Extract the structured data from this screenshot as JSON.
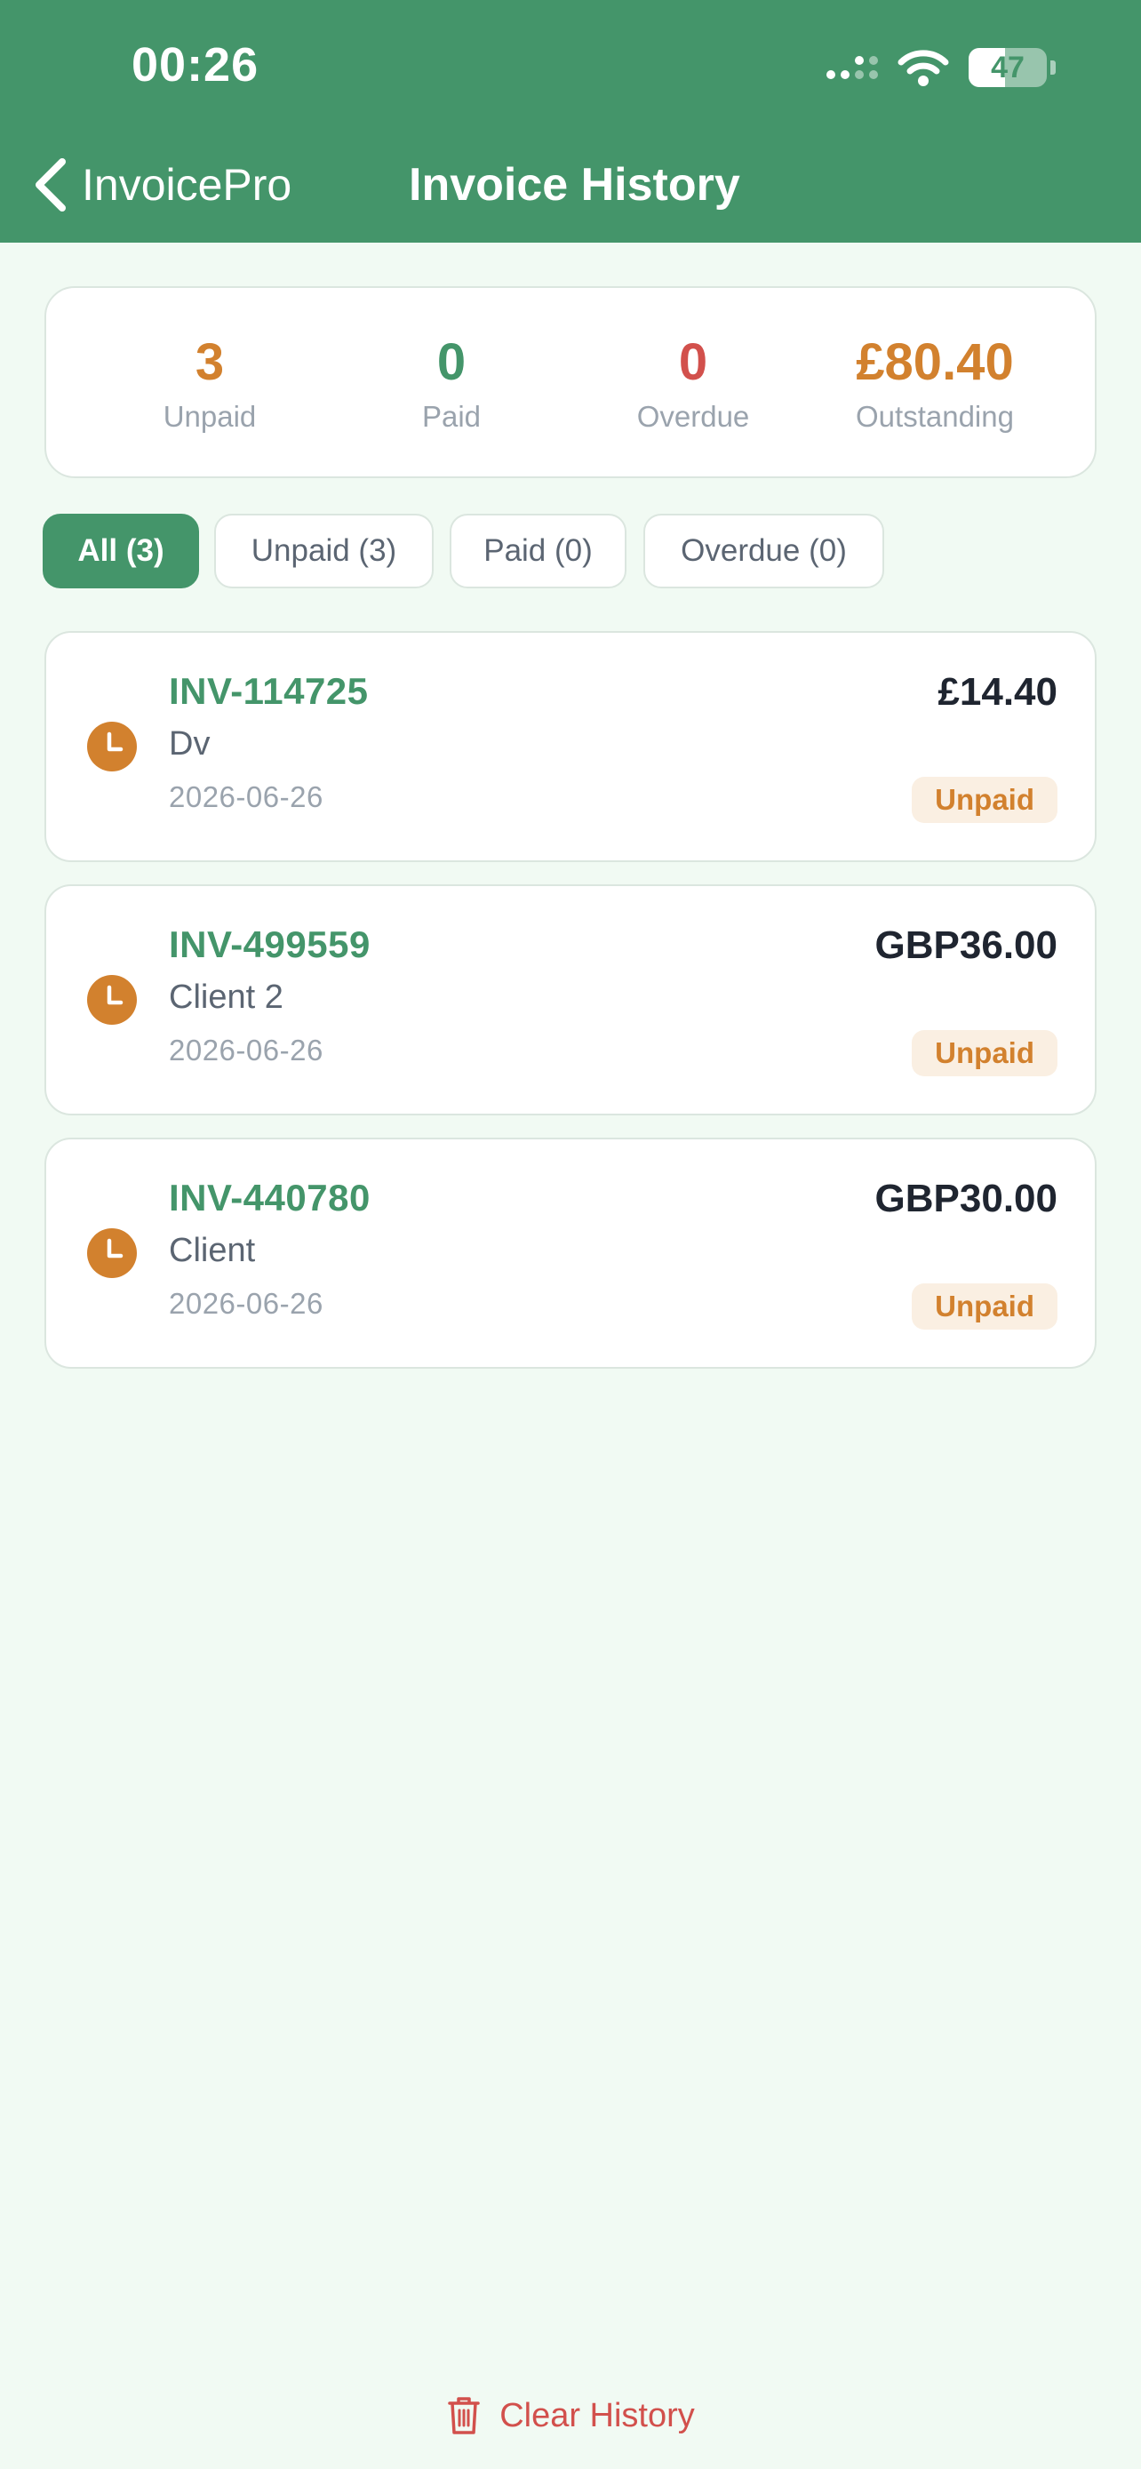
{
  "status_bar": {
    "time": "00:26",
    "battery": "47",
    "battery_level": 0.47
  },
  "nav": {
    "back_label": "InvoicePro",
    "title": "Invoice History"
  },
  "summary": [
    {
      "value": "3",
      "label": "Unpaid",
      "color": "#d2812e"
    },
    {
      "value": "0",
      "label": "Paid",
      "color": "#44956a"
    },
    {
      "value": "0",
      "label": "Overdue",
      "color": "#d2504c"
    },
    {
      "value": "£80.40",
      "label": "Outstanding",
      "color": "#d2812e"
    }
  ],
  "filters": [
    {
      "label": "All (3)",
      "active": true
    },
    {
      "label": "Unpaid (3)",
      "active": false
    },
    {
      "label": "Paid (0)",
      "active": false
    },
    {
      "label": "Overdue (0)",
      "active": false
    }
  ],
  "invoices": [
    {
      "number": "INV-114725",
      "client": "Dv",
      "date": "2026-06-26",
      "amount": "£14.40",
      "status": "Unpaid",
      "icon": "clock-icon"
    },
    {
      "number": "INV-499559",
      "client": "Client 2",
      "date": "2026-06-26",
      "amount": "GBP36.00",
      "status": "Unpaid",
      "icon": "clock-icon"
    },
    {
      "number": "INV-440780",
      "client": "Client",
      "date": "2026-06-26",
      "amount": "GBP30.00",
      "status": "Unpaid",
      "icon": "clock-icon"
    }
  ],
  "footer": {
    "clear_label": "Clear History",
    "icon": "trash-icon"
  },
  "colors": {
    "brand": "#44956a",
    "unpaid": "#d2812e",
    "overdue": "#d2504c",
    "background": "#f1faf3"
  }
}
